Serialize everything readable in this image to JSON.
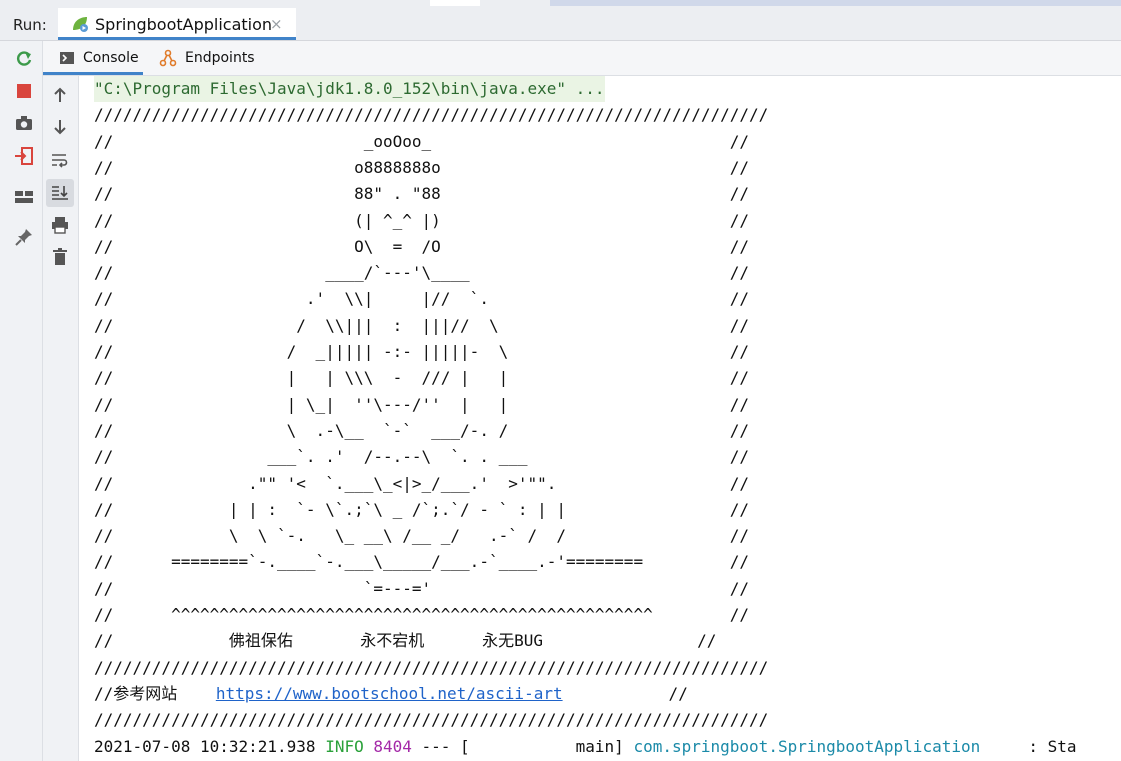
{
  "run": {
    "label": "Run:",
    "tab_title": "SpringbootApplication",
    "tab_close": "×"
  },
  "subtabs": {
    "console": "Console",
    "endpoints": "Endpoints"
  },
  "colors": {
    "accent": "#4083c9",
    "info": "#2aa13a",
    "pid": "#a429a8",
    "class": "#1b8aa8",
    "link": "#1f63c9",
    "cmd_bg": "#eaf4e4",
    "cmd_text": "#2d6a31"
  },
  "console": {
    "command": "\"C:\\Program Files\\Java\\jdk1.8.0_152\\bin\\java.exe\" ...",
    "banner_lines": [
      "//////////////////////////////////////////////////////////////////////",
      "//                          _ooOoo_                               //",
      "//                         o8888888o                              //",
      "//                         88\" . \"88                              //",
      "//                         (| ^_^ |)                              //",
      "//                         O\\  =  /O                              //",
      "//                      ____/`---'\\____                           //",
      "//                    .'  \\\\|     |//  `.                         //",
      "//                   /  \\\\|||  :  |||//  \\                        //",
      "//                  /  _||||| -:- |||||-  \\                       //",
      "//                  |   | \\\\\\  -  /// |   |                       //",
      "//                  | \\_|  ''\\---/''  |   |                       //",
      "//                  \\  .-\\__  `-`  ___/-. /                       //",
      "//                ___`. .'  /--.--\\  `. . ___                     //",
      "//              .\"\" '<  `.___\\_<|>_/___.'  >'\"\".                  //",
      "//            | | :  `- \\`.;`\\ _ /`;.`/ - ` : | |                 //",
      "//            \\  \\ `-.   \\_ __\\ /__ _/   .-` /  /                 //",
      "//      ========`-.____`-.___\\_____/___.-`____.-'========         //",
      "//                          `=---='                               //",
      "//      ^^^^^^^^^^^^^^^^^^^^^^^^^^^^^^^^^^^^^^^^^^^^^^^^^^        //",
      "//            佛祖保佑       永不宕机      永无BUG                //",
      "//////////////////////////////////////////////////////////////////////"
    ],
    "ref_prefix": "//参考网站    ",
    "ref_url": "https://www.bootschool.net/ascii-art",
    "ref_suffix": "           //",
    "banner_end": "//////////////////////////////////////////////////////////////////////",
    "log": {
      "timestamp": "2021-07-08 10:32:21.938 ",
      "level": "INFO",
      "pid": "8404",
      "sep": " --- [           main] ",
      "logger": "com.springboot.SpringbootApplication",
      "tail": "     : Sta"
    }
  }
}
